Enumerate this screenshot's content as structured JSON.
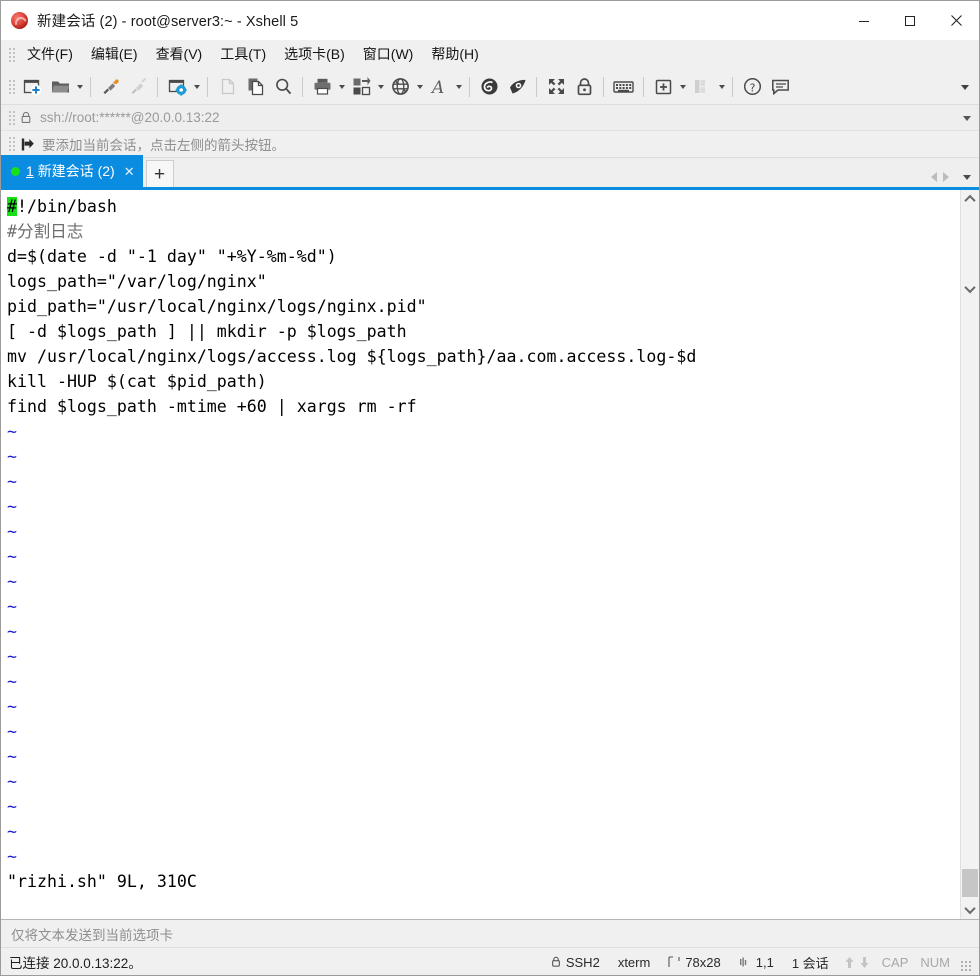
{
  "window": {
    "title": "新建会话 (2) - root@server3:~ - Xshell 5",
    "logo_icon": "xshell-logo-icon",
    "minimize_label": "最小化",
    "maximize_label": "最大化",
    "close_label": "关闭"
  },
  "menu": {
    "items": [
      {
        "label": "文件(F)",
        "name": "menu-file"
      },
      {
        "label": "编辑(E)",
        "name": "menu-edit"
      },
      {
        "label": "查看(V)",
        "name": "menu-view"
      },
      {
        "label": "工具(T)",
        "name": "menu-tools"
      },
      {
        "label": "选项卡(B)",
        "name": "menu-tabs"
      },
      {
        "label": "窗口(W)",
        "name": "menu-window"
      },
      {
        "label": "帮助(H)",
        "name": "menu-help"
      }
    ]
  },
  "toolbar": {
    "buttons": [
      {
        "icon": "new-session-icon",
        "dropdown": false,
        "disabled": false
      },
      {
        "icon": "open-folder-icon",
        "dropdown": true,
        "disabled": false
      },
      {
        "sep": true
      },
      {
        "icon": "connect-plug-icon",
        "dropdown": false,
        "disabled": false
      },
      {
        "icon": "disconnect-plug-icon",
        "dropdown": false,
        "disabled": true
      },
      {
        "sep": true
      },
      {
        "icon": "session-properties-icon",
        "dropdown": true,
        "disabled": false
      },
      {
        "sep": true
      },
      {
        "icon": "paste-plain-icon",
        "dropdown": false,
        "disabled": true
      },
      {
        "icon": "copy-icon",
        "dropdown": false,
        "disabled": false
      },
      {
        "icon": "find-icon",
        "dropdown": false,
        "disabled": false
      },
      {
        "sep": true
      },
      {
        "icon": "print-icon",
        "dropdown": true,
        "disabled": false
      },
      {
        "icon": "file-transfer-icon",
        "dropdown": true,
        "disabled": false
      },
      {
        "icon": "globe-icon",
        "dropdown": true,
        "disabled": false
      },
      {
        "icon": "font-icon",
        "dropdown": true,
        "disabled": false
      },
      {
        "sep": true
      },
      {
        "icon": "xftp-icon",
        "dropdown": false,
        "disabled": false
      },
      {
        "icon": "xagent-icon",
        "dropdown": false,
        "disabled": false
      },
      {
        "sep": true
      },
      {
        "icon": "fullscreen-icon",
        "dropdown": false,
        "disabled": false
      },
      {
        "icon": "lock-icon",
        "dropdown": false,
        "disabled": false
      },
      {
        "sep": true
      },
      {
        "icon": "keyboard-icon",
        "dropdown": false,
        "disabled": false
      },
      {
        "sep": true
      },
      {
        "icon": "add-to-folder-icon",
        "dropdown": true,
        "disabled": false
      },
      {
        "icon": "layout-icon",
        "dropdown": true,
        "disabled": true
      },
      {
        "sep": true
      },
      {
        "icon": "help-icon",
        "dropdown": false,
        "disabled": false
      },
      {
        "icon": "comment-icon",
        "dropdown": false,
        "disabled": false
      }
    ],
    "overflow_label": "更多工具栏按钮"
  },
  "address_bar": {
    "lock_icon": "lock-icon",
    "value": "ssh://root:******@20.0.0.13:22",
    "placeholder": "ssh://root:******@20.0.0.13:22"
  },
  "hint_bar": {
    "icon": "add-session-arrow-icon",
    "text": "要添加当前会话，点击左侧的箭头按钮。"
  },
  "tabs": {
    "items": [
      {
        "index": "1",
        "title": "新建会话 (2)",
        "status_dot": "connected-dot-icon",
        "close_icon": "close-icon",
        "active": true
      }
    ],
    "new_tab_label": "+",
    "nav_prev_icon": "triangle-left-icon",
    "nav_next_icon": "triangle-right-icon",
    "nav_menu_icon": "chevron-down-icon"
  },
  "terminal": {
    "cursor_char": "#",
    "lines": [
      {
        "type": "cursor_line",
        "cursor": "#",
        "rest": "!/bin/bash"
      },
      {
        "type": "comment",
        "text": "#分割日志"
      },
      {
        "type": "text",
        "text": "d=$(date -d \"-1 day\" \"+%Y-%m-%d\")"
      },
      {
        "type": "text",
        "text": "logs_path=\"/var/log/nginx\""
      },
      {
        "type": "text",
        "text": "pid_path=\"/usr/local/nginx/logs/nginx.pid\""
      },
      {
        "type": "text",
        "text": "[ -d $logs_path ] || mkdir -p $logs_path"
      },
      {
        "type": "text",
        "text": "mv /usr/local/nginx/logs/access.log ${logs_path}/aa.com.access.log-$d"
      },
      {
        "type": "text",
        "text": "kill -HUP $(cat $pid_path)"
      },
      {
        "type": "text",
        "text": "find $logs_path -mtime +60 | xargs rm -rf"
      },
      {
        "type": "tilde",
        "text": "~"
      },
      {
        "type": "tilde",
        "text": "~"
      },
      {
        "type": "tilde",
        "text": "~"
      },
      {
        "type": "tilde",
        "text": "~"
      },
      {
        "type": "tilde",
        "text": "~"
      },
      {
        "type": "tilde",
        "text": "~"
      },
      {
        "type": "tilde",
        "text": "~"
      },
      {
        "type": "tilde",
        "text": "~"
      },
      {
        "type": "tilde",
        "text": "~"
      },
      {
        "type": "tilde",
        "text": "~"
      },
      {
        "type": "tilde",
        "text": "~"
      },
      {
        "type": "tilde",
        "text": "~"
      },
      {
        "type": "tilde",
        "text": "~"
      },
      {
        "type": "tilde",
        "text": "~"
      },
      {
        "type": "tilde",
        "text": "~"
      },
      {
        "type": "tilde",
        "text": "~"
      },
      {
        "type": "tilde",
        "text": "~"
      },
      {
        "type": "tilde",
        "text": "~"
      },
      {
        "type": "status",
        "text": "\"rizhi.sh\" 9L, 310C"
      }
    ]
  },
  "send_bar": {
    "text": "仅将文本发送到当前选项卡"
  },
  "status_bar": {
    "connection": "已连接 20.0.0.13:22。",
    "protocol": "SSH2",
    "protocol_icon": "lock-icon",
    "terminal_type": "xterm",
    "size": "78x28",
    "size_icon": "terminal-size-icon",
    "cursor_pos": "1,1",
    "cursor_icon": "cursor-pos-icon",
    "sessions": "1 会话",
    "up_icon": "arrow-up-icon",
    "down_icon": "arrow-down-icon",
    "caps": "CAP",
    "num": "NUM"
  },
  "colors": {
    "accent": "#0a8ce0",
    "cursor": "#17e017",
    "tilde": "#1b1bd2",
    "chrome": "#f0f0f0",
    "logo": "#c02018"
  }
}
